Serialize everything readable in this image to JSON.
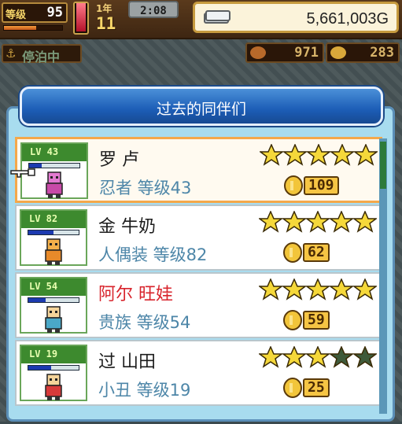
{
  "hud": {
    "level_label": "等级",
    "level_value": "95",
    "level_progress": 0.55,
    "gauge_level": 0.95,
    "date_label": "1年",
    "date_value": "11",
    "clock": "2:08",
    "money": "5,661,003G"
  },
  "dock": {
    "label": "停泊中"
  },
  "resources": [
    {
      "name": "food",
      "value": "971"
    },
    {
      "name": "coins",
      "value": "283"
    }
  ],
  "dialog": {
    "title": "过去的同伴们"
  },
  "companions": [
    {
      "level_badge": "LV 43",
      "name": "罗 卢",
      "name_color": "default",
      "job_level": "忍者 等级43",
      "stars": 5,
      "price": "109",
      "exp": 0.25,
      "selected": true
    },
    {
      "level_badge": "LV 82",
      "name": "金 牛奶",
      "name_color": "default",
      "job_level": "人偶装 等级82",
      "stars": 5,
      "price": "62",
      "exp": 0.5,
      "selected": false
    },
    {
      "level_badge": "LV 54",
      "name": "阿尔 旺娃",
      "name_color": "red",
      "job_level": "贵族 等级54",
      "stars": 5,
      "price": "59",
      "exp": 0.35,
      "selected": false
    },
    {
      "level_badge": "LV 19",
      "name": "过 山田",
      "name_color": "default",
      "job_level": "小丑 等级19",
      "stars": 3,
      "price": "25",
      "exp": 0.45,
      "selected": false
    }
  ],
  "max_stars": 5,
  "colors": {
    "star_filled": "#f5d83a",
    "star_empty": "#3e5a3a",
    "dialog_header": "#1c5db6",
    "name_red": "#d8242c"
  }
}
